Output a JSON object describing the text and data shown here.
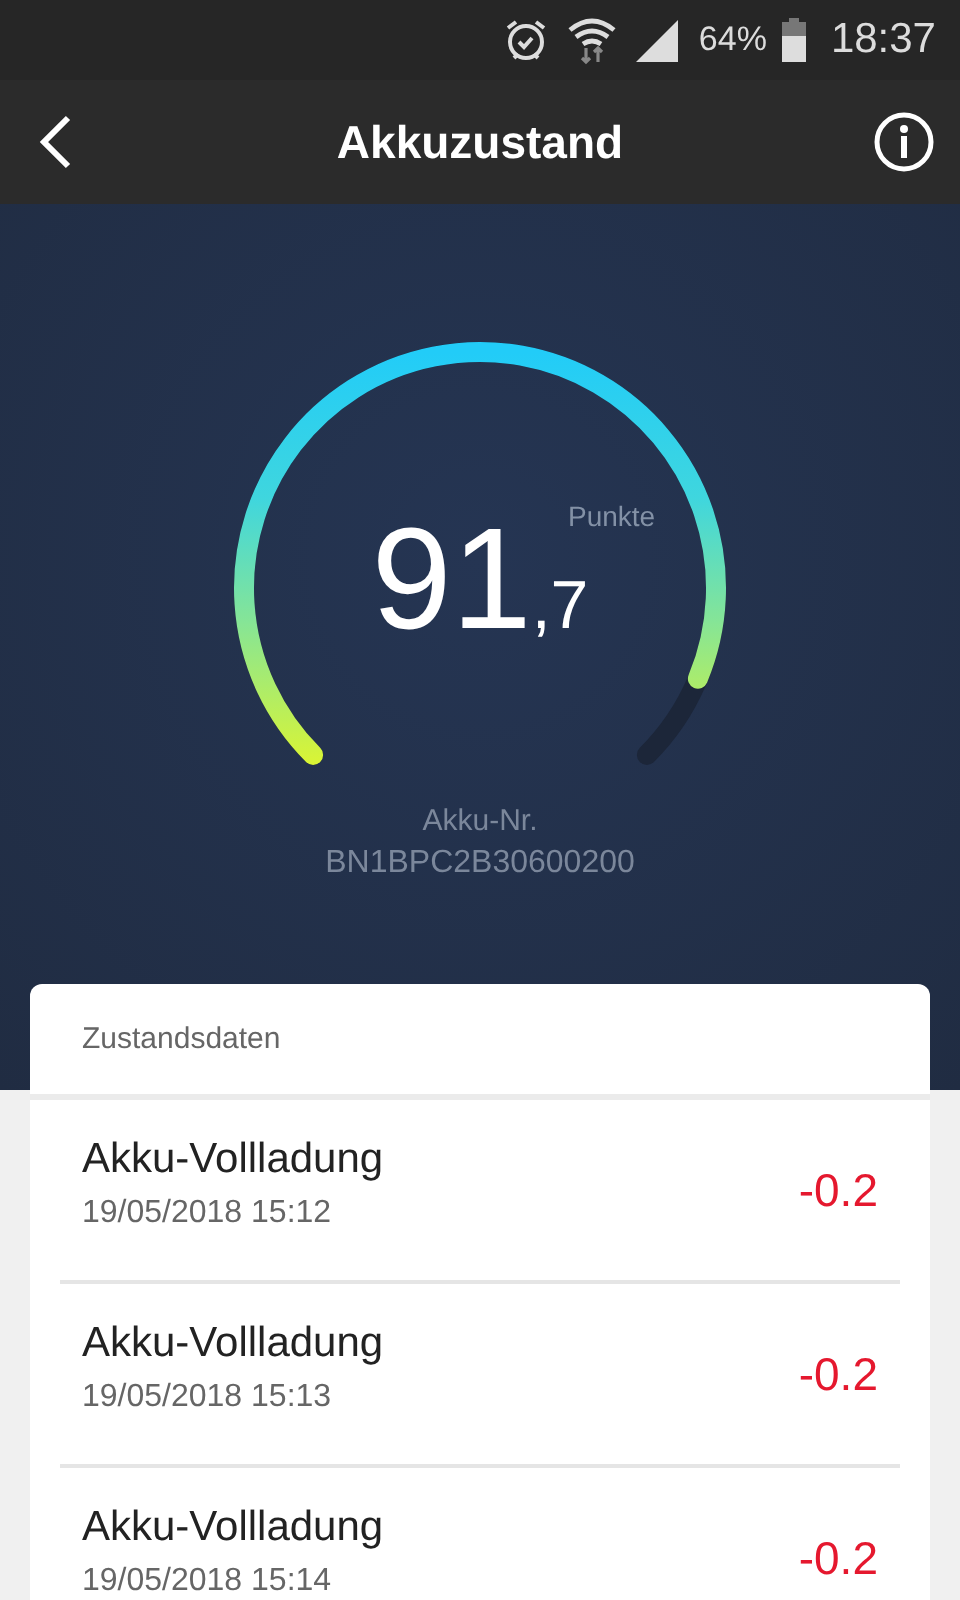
{
  "status_bar": {
    "battery": "64%",
    "time": "18:37"
  },
  "header": {
    "title": "Akkuzustand"
  },
  "gauge": {
    "score_integer": "91",
    "score_decimal": ",7",
    "unit": "Punkte",
    "serial_label": "Akku-Nr.",
    "serial": "BN1BPC2B30600200"
  },
  "card": {
    "title": "Zustandsdaten",
    "rows": [
      {
        "label": "Akku-Vollladung",
        "date": "19/05/2018 15:12",
        "value": "-0.2"
      },
      {
        "label": "Akku-Vollladung",
        "date": "19/05/2018 15:13",
        "value": "-0.2"
      },
      {
        "label": "Akku-Vollladung",
        "date": "19/05/2018 15:14",
        "value": "-0.2"
      }
    ]
  }
}
